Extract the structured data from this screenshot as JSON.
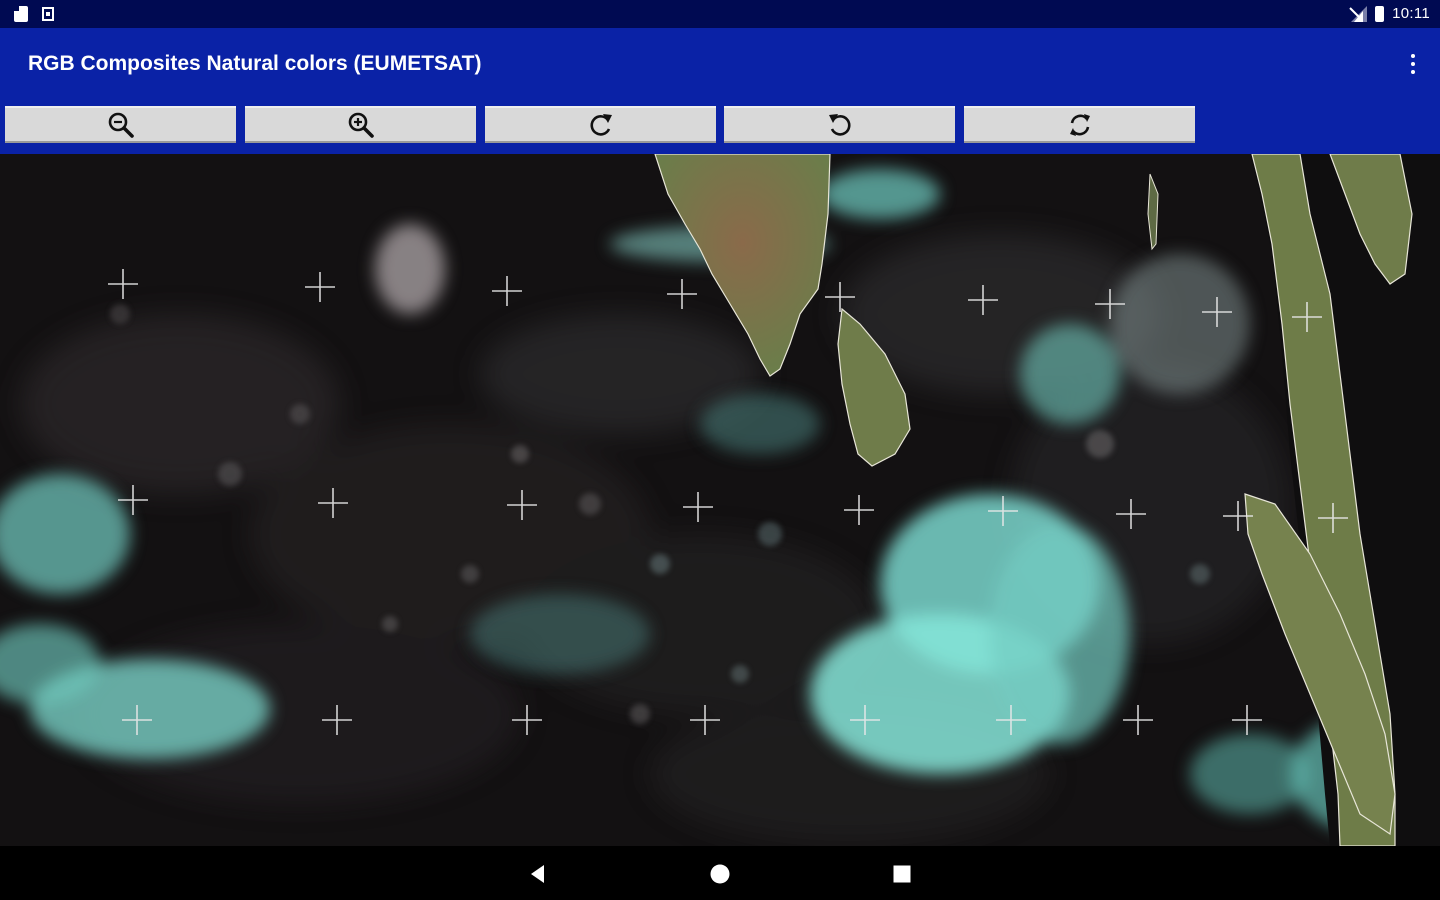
{
  "status_bar": {
    "time": "10:11",
    "icons": [
      "sd-card-icon",
      "screenshot-icon",
      "signal-icon",
      "battery-icon"
    ]
  },
  "app_bar": {
    "title": "RGB Composites Natural colors (EUMETSAT)",
    "menu_icon": "more-vert-icon"
  },
  "toolbar": {
    "buttons": [
      {
        "name": "zoom-out-button",
        "icon": "zoom-out-icon"
      },
      {
        "name": "zoom-in-button",
        "icon": "zoom-in-icon"
      },
      {
        "name": "rotate-right-button",
        "icon": "rotate-right-icon"
      },
      {
        "name": "rotate-left-button",
        "icon": "rotate-left-icon"
      },
      {
        "name": "refresh-button",
        "icon": "refresh-icon"
      }
    ]
  },
  "image": {
    "description_type": "satellite-rgb-composite",
    "colors": {
      "ocean": "#121010",
      "land": "#7a6b4e",
      "cloud": "#7ee3d6",
      "toolbar_bg": "#0a22a6",
      "status_bg": "#000a52",
      "button_bg": "#d9d9d9"
    }
  },
  "nav_bar": {
    "buttons": [
      "back-icon",
      "home-icon",
      "recents-icon"
    ]
  }
}
